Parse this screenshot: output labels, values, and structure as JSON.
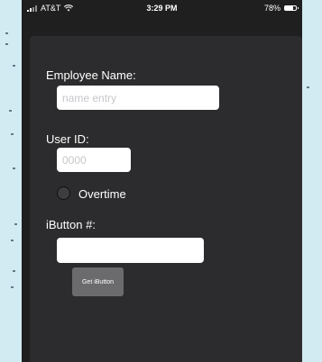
{
  "status_bar": {
    "carrier": "AT&T",
    "time": "3:29 PM",
    "battery": "78%",
    "battery_level": 0.78,
    "icons": [
      "signal-icon",
      "wifi-icon",
      "battery-icon"
    ]
  },
  "form": {
    "employee_name": {
      "label": "Employee Name:",
      "value": "",
      "placeholder": "name entry"
    },
    "user_id": {
      "label": "User ID:",
      "value": "",
      "placeholder": "0000"
    },
    "overtime": {
      "label": "Overtime",
      "selected": false
    },
    "ibutton": {
      "label": "iButton #:",
      "value": "",
      "placeholder": ""
    },
    "get_ibutton_button": "Get iButton"
  },
  "colors": {
    "background": "#2c2c2e",
    "frame": "#1f1f20",
    "button": "#6b6b6e",
    "page": "#d2ebf3"
  }
}
